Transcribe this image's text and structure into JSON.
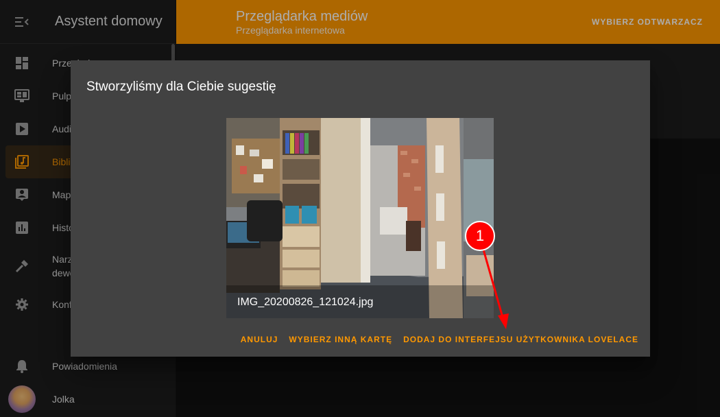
{
  "sidebar": {
    "title": "Asystent domowy",
    "items": [
      {
        "label": "Przegląd",
        "icon": "dashboard-icon"
      },
      {
        "label": "Pulpit",
        "icon": "monitor-dashboard-icon"
      },
      {
        "label": "Audio",
        "icon": "play-box-icon"
      },
      {
        "label": "Biblioteka",
        "icon": "music-library-icon"
      },
      {
        "label": "Mapa",
        "icon": "account-box-icon"
      },
      {
        "label": "Historia",
        "icon": "chart-box-icon"
      },
      {
        "label": "Narzędzia deweloperskie",
        "icon": "hammer-icon"
      },
      {
        "label": "Konfiguracja",
        "icon": "gear-icon"
      }
    ],
    "notifications_label": "Powiadomienia",
    "user_label": "Jolka"
  },
  "header": {
    "title": "Przeglądarka mediów",
    "subtitle": "Przeglądarka internetowa",
    "action_label": "WYBIERZ ODTWARZACZ"
  },
  "dialog": {
    "title": "Stworzyliśmy dla Ciebie sugestię",
    "card_name": "IMG_20200826_121024.jpg",
    "buttons": {
      "cancel": "ANULUJ",
      "choose_other": "WYBIERZ INNĄ KARTĘ",
      "add": "DODAJ DO INTERFEJSU UŻYTKOWNIKA LOVELACE"
    }
  },
  "annotation": {
    "number": "1",
    "color": "#ff0000"
  },
  "colors": {
    "accent": "#ff9800",
    "sidebar_bg": "#1c1c1c",
    "dialog_bg": "#424242"
  }
}
